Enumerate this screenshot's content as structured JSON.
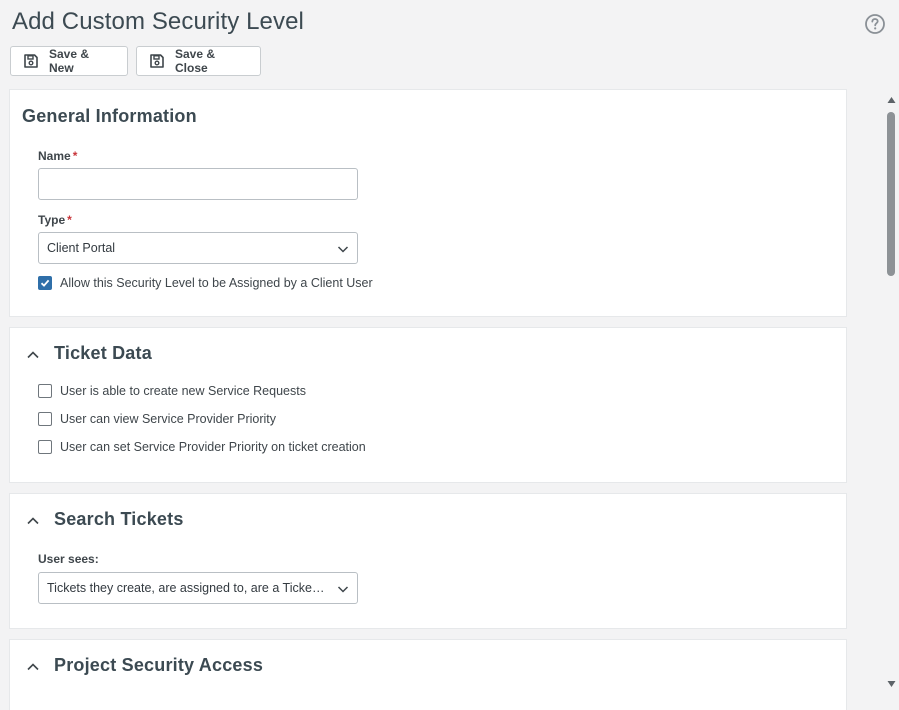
{
  "page": {
    "title": "Add Custom Security Level"
  },
  "toolbar": {
    "save_new_label": "Save & New",
    "save_close_label": "Save & Close"
  },
  "icons": {
    "help": "help-circle-icon",
    "save": "save-disk-icon",
    "chevron_up": "chevron-up-icon",
    "chevron_down": "chevron-down-icon"
  },
  "general": {
    "title": "General Information",
    "name_label": "Name",
    "name_value": "",
    "type_label": "Type",
    "type_value": "Client Portal",
    "required_mark": "*",
    "allow_assign_label": "Allow this Security Level to be Assigned by a Client User",
    "allow_assign_checked": true
  },
  "ticket_data": {
    "title": "Ticket Data",
    "options": [
      {
        "label": "User is able to create new Service Requests",
        "checked": false
      },
      {
        "label": "User can view Service Provider Priority",
        "checked": false
      },
      {
        "label": "User can set Service Provider Priority on ticket creation",
        "checked": false
      }
    ]
  },
  "search_tickets": {
    "title": "Search Tickets",
    "user_sees_label": "User sees:",
    "user_sees_value": "Tickets they create, are assigned to, are a Ticket Contact for"
  },
  "project_security": {
    "title": "Project Security Access"
  },
  "colors": {
    "accent": "#2f6fa9",
    "required": "#c8353a",
    "background": "#f3f3f4"
  }
}
